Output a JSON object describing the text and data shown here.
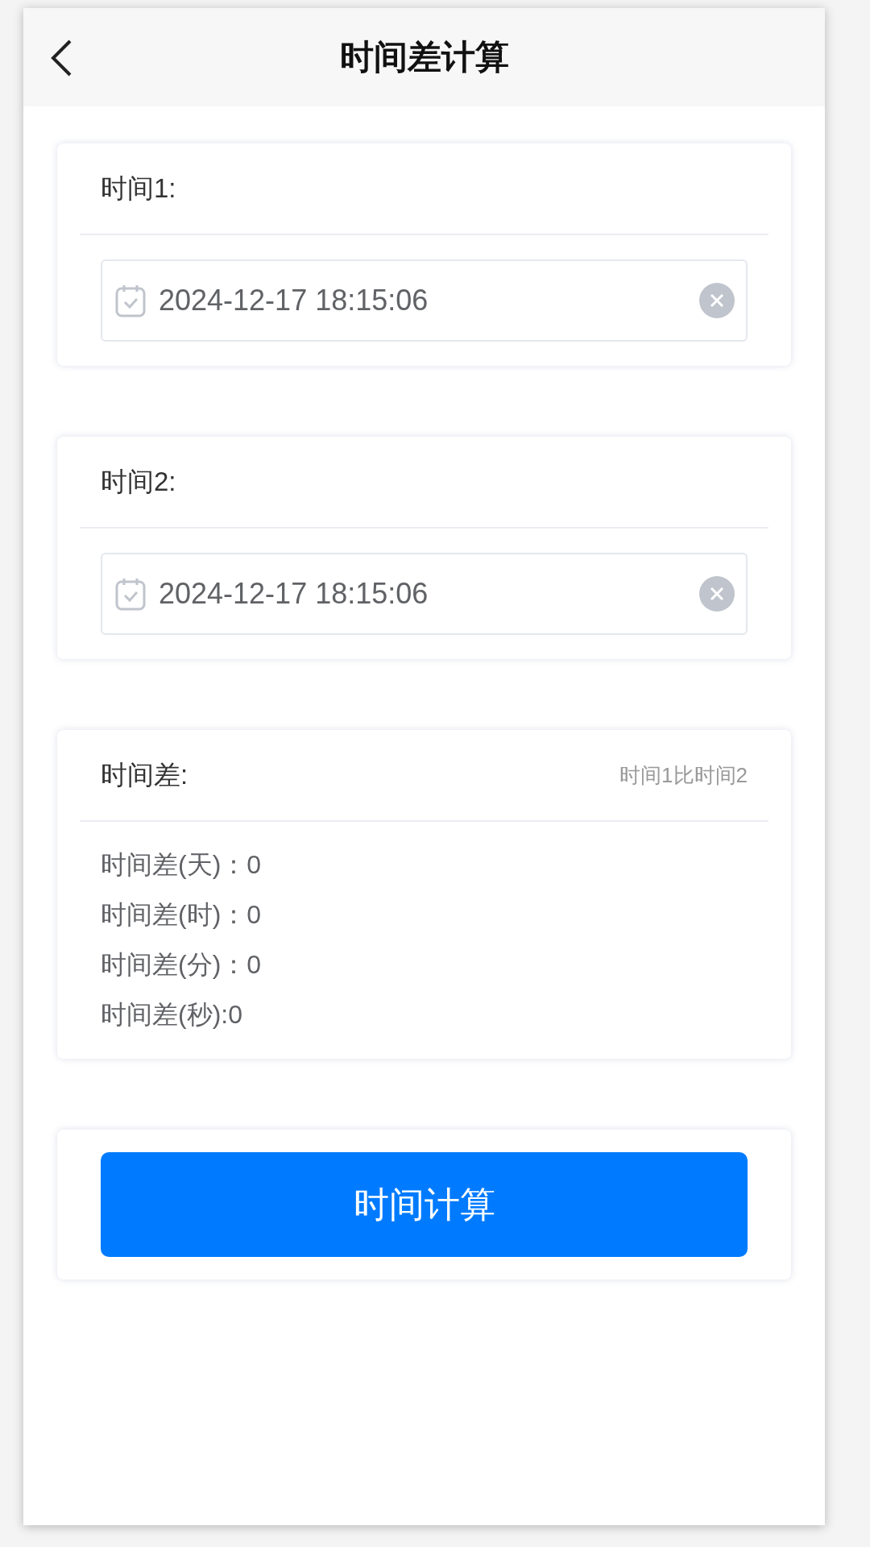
{
  "header": {
    "title": "时间差计算"
  },
  "time_fields": [
    {
      "label": "时间1:",
      "value": "2024-12-17 18:15:06"
    },
    {
      "label": "时间2:",
      "value": "2024-12-17 18:15:06"
    }
  ],
  "result": {
    "title": "时间差:",
    "note": "时间1比时间2",
    "lines": [
      "时间差(天)：0",
      "时间差(时)：0",
      "时间差(分)：0",
      "时间差(秒):0"
    ]
  },
  "button": {
    "label": "时间计算"
  }
}
